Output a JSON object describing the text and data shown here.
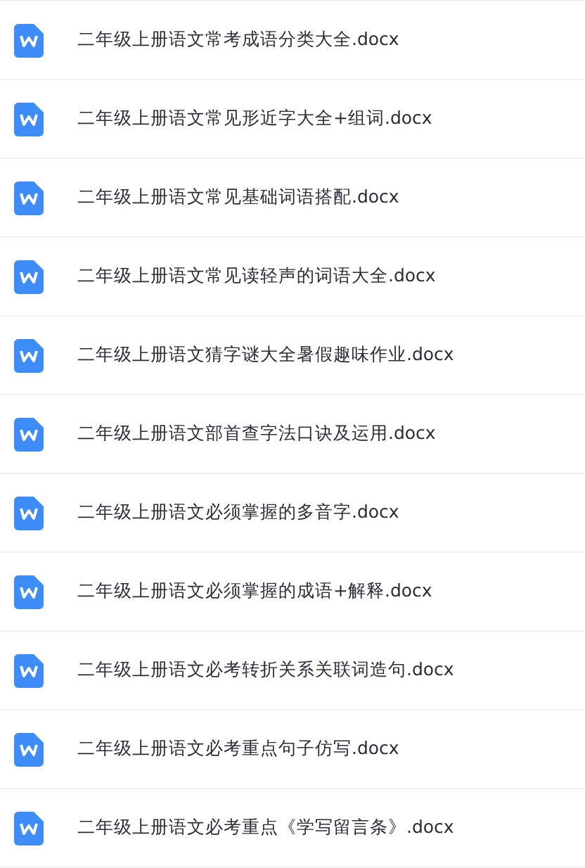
{
  "files": [
    {
      "name": "二年级上册语文常考成语分类大全.docx"
    },
    {
      "name": "二年级上册语文常见形近字大全+组词.docx"
    },
    {
      "name": "二年级上册语文常见基础词语搭配.docx"
    },
    {
      "name": "二年级上册语文常见读轻声的词语大全.docx"
    },
    {
      "name": "二年级上册语文猜字谜大全暑假趣味作业.docx"
    },
    {
      "name": "二年级上册语文部首查字法口诀及运用.docx"
    },
    {
      "name": "二年级上册语文必须掌握的多音字.docx"
    },
    {
      "name": "二年级上册语文必须掌握的成语+解释.docx"
    },
    {
      "name": "二年级上册语文必考转折关系关联词造句.docx"
    },
    {
      "name": "二年级上册语文必考重点句子仿写.docx"
    },
    {
      "name": "二年级上册语文必考重点《学写留言条》.docx"
    }
  ]
}
